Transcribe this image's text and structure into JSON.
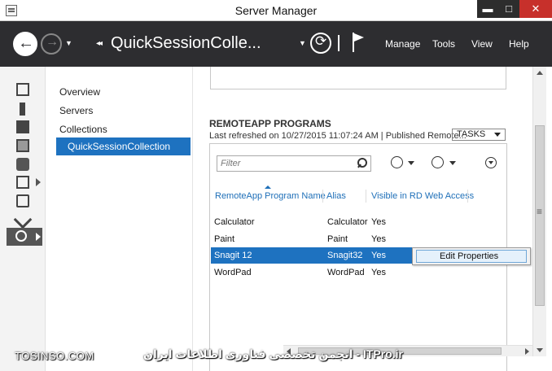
{
  "window": {
    "title": "Server Manager",
    "controls": {
      "minimize": "▬",
      "maximize": "□",
      "close": "✕"
    }
  },
  "toolbar": {
    "breadcrumb_separator": "◂◂",
    "breadcrumb": "QuickSessionColle...",
    "menus": [
      "Manage",
      "Tools",
      "View",
      "Help"
    ]
  },
  "nav": {
    "items": [
      {
        "label": "Overview"
      },
      {
        "label": "Servers"
      },
      {
        "label": "Collections"
      },
      {
        "label": "QuickSessionCollection",
        "selected": true
      }
    ]
  },
  "remoteapp": {
    "section_title": "REMOTEAPP PROGRAMS",
    "last_refreshed": "Last refreshed on 10/27/2015 11:07:24 AM | Published Remote...",
    "tasks_label": "TASKS",
    "filter_placeholder": "Filter",
    "columns": [
      "RemoteApp Program Name",
      "Alias",
      "Visible in RD Web Access"
    ],
    "rows": [
      {
        "name": "Calculator",
        "alias": "Calculator",
        "visible": "Yes",
        "selected": false
      },
      {
        "name": "Paint",
        "alias": "Paint",
        "visible": "Yes",
        "selected": false
      },
      {
        "name": "Snagit 12",
        "alias": "Snagit32",
        "visible": "Yes",
        "selected": true
      },
      {
        "name": "WordPad",
        "alias": "WordPad",
        "visible": "Yes",
        "selected": false
      }
    ]
  },
  "context_menu": {
    "items": [
      "Edit Properties"
    ]
  },
  "watermark": {
    "left": "TOSINSO.COM",
    "right": "ITPro.ir - انجمن تخصصی فناوری اطلاعات ایران"
  },
  "colors": {
    "accent": "#1e72c0",
    "toolbar_bg": "#2d2d30",
    "close_button": "#c7302b"
  }
}
